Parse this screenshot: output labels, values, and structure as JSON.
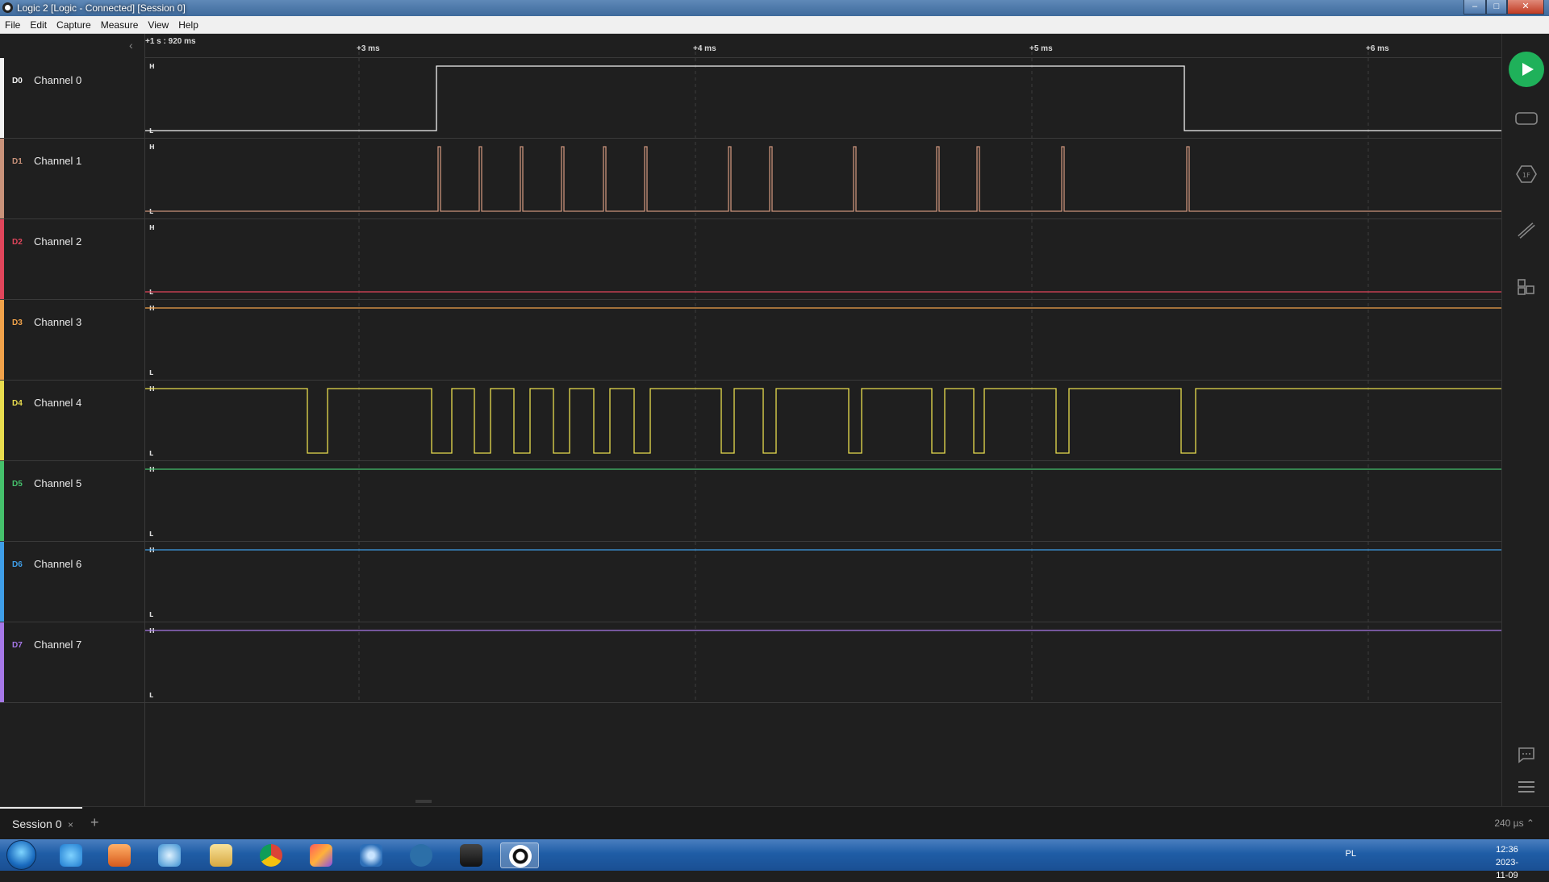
{
  "window": {
    "title": "Logic 2 [Logic - Connected] [Session 0]",
    "buttons": [
      "–",
      "□",
      "✕"
    ]
  },
  "menu": [
    "File",
    "Edit",
    "Capture",
    "Measure",
    "View",
    "Help"
  ],
  "timeline": {
    "origin": "+1 s : 920 ms",
    "ticks": [
      "+3 ms",
      "+4 ms",
      "+5 ms",
      "+6 ms"
    ]
  },
  "level_labels": {
    "high": "H",
    "low": "L"
  },
  "channels": [
    {
      "tag": "D0",
      "name": "Channel 0",
      "color": "#f2f2f2"
    },
    {
      "tag": "D1",
      "name": "Channel 1",
      "color": "#c9927a"
    },
    {
      "tag": "D2",
      "name": "Channel 2",
      "color": "#e0455b"
    },
    {
      "tag": "D3",
      "name": "Channel 3",
      "color": "#f0a24a"
    },
    {
      "tag": "D4",
      "name": "Channel 4",
      "color": "#e8dc4e"
    },
    {
      "tag": "D5",
      "name": "Channel 5",
      "color": "#45c16c"
    },
    {
      "tag": "D6",
      "name": "Channel 6",
      "color": "#3f9ee8"
    },
    {
      "tag": "D7",
      "name": "Channel 7",
      "color": "#a678e8"
    }
  ],
  "session": {
    "tab": "Session 0",
    "close": "×",
    "add": "+",
    "zoom": "240 µs ⌃"
  },
  "tray": {
    "lang": "PL",
    "time": "12:36",
    "date": "2023-11-09"
  }
}
